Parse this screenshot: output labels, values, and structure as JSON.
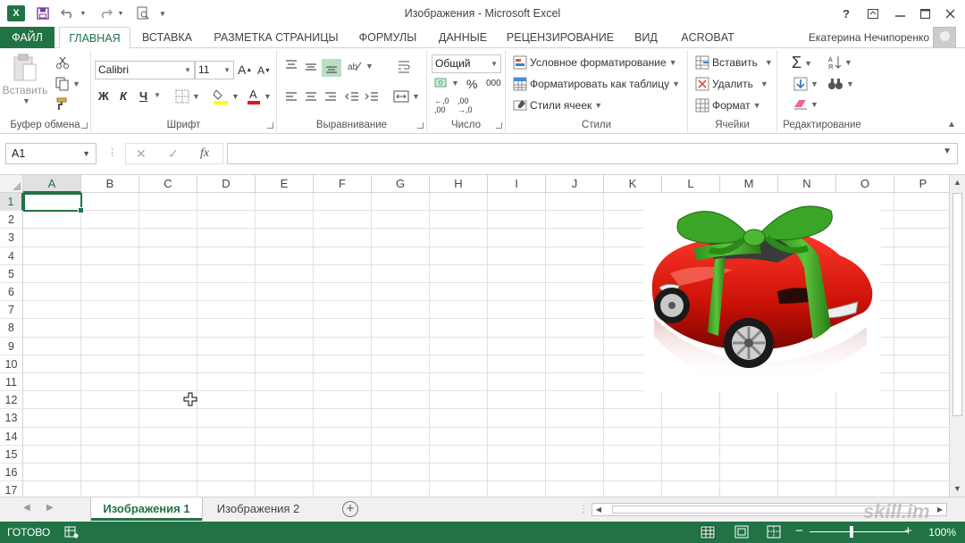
{
  "window": {
    "title": "Изображения - Microsoft Excel",
    "app_logo": "X",
    "help_label": "?",
    "icons": [
      "excel-logo-icon",
      "save-icon",
      "undo-icon",
      "redo-icon",
      "print-preview-icon",
      "customize-qat-icon",
      "help-icon",
      "ribbon-display-options-icon",
      "minimize-icon",
      "restore-icon",
      "close-icon"
    ]
  },
  "tabs": {
    "file": "ФАЙЛ",
    "items": [
      "ГЛАВНАЯ",
      "ВСТАВКА",
      "РАЗМЕТКА СТРАНИЦЫ",
      "ФОРМУЛЫ",
      "ДАННЫЕ",
      "РЕЦЕНЗИРОВАНИЕ",
      "ВИД",
      "ACROBAT"
    ],
    "active": "ГЛАВНАЯ",
    "user": "Екатерина Нечипоренко"
  },
  "ribbon": {
    "clipboard": {
      "paste": "Вставить",
      "label": "Буфер обмена"
    },
    "font": {
      "name": "Calibri",
      "size": "11",
      "bold": "Ж",
      "italic": "К",
      "underline": "Ч",
      "label": "Шрифт"
    },
    "alignment": {
      "label": "Выравнивание"
    },
    "number": {
      "format": "Общий",
      "percent": "%",
      "thousands": "000",
      "label": "Число"
    },
    "styles": {
      "conditional": "Условное форматирование",
      "table": "Форматировать как таблицу",
      "cell_styles": "Стили ячеек",
      "label": "Стили"
    },
    "cells": {
      "insert": "Вставить",
      "delete": "Удалить",
      "format": "Формат",
      "label": "Ячейки"
    },
    "editing": {
      "sum": "Σ",
      "label": "Редактирование"
    }
  },
  "formula_bar": {
    "name_box": "A1",
    "fx": "fx",
    "cancel": "✕",
    "enter": "✓",
    "value": ""
  },
  "grid": {
    "columns": [
      "A",
      "B",
      "C",
      "D",
      "E",
      "F",
      "G",
      "H",
      "I",
      "J",
      "K",
      "L",
      "M",
      "N",
      "O",
      "P"
    ],
    "rows": [
      "1",
      "2",
      "3",
      "4",
      "5",
      "6",
      "7",
      "8",
      "9",
      "10",
      "11",
      "12",
      "13",
      "14",
      "15",
      "16",
      "17"
    ],
    "active_cell": "A1",
    "picture": "red-sports-car-with-green-bow"
  },
  "sheets": {
    "tabs": [
      "Изображения 1",
      "Изображения 2"
    ],
    "active": "Изображения 1",
    "add": "+"
  },
  "status": {
    "ready": "ГОТОВО",
    "zoom": "100%",
    "zoom_minus": "−",
    "zoom_plus": "+"
  },
  "watermark": "skill.im"
}
